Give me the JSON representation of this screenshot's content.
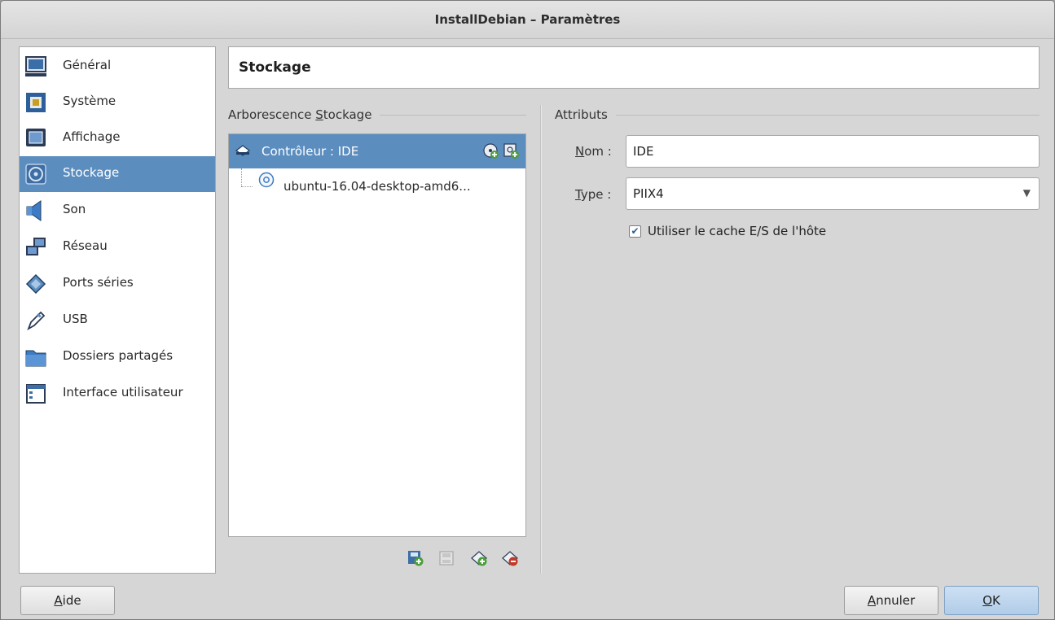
{
  "window": {
    "title": "InstallDebian – Paramètres"
  },
  "sidebar": {
    "items": [
      {
        "label": "Général",
        "icon": "monitor-icon"
      },
      {
        "label": "Système",
        "icon": "chip-icon"
      },
      {
        "label": "Affichage",
        "icon": "display-icon"
      },
      {
        "label": "Stockage",
        "icon": "storage-icon",
        "selected": true
      },
      {
        "label": "Son",
        "icon": "speaker-icon"
      },
      {
        "label": "Réseau",
        "icon": "network-icon"
      },
      {
        "label": "Ports séries",
        "icon": "serial-port-icon"
      },
      {
        "label": "USB",
        "icon": "usb-icon"
      },
      {
        "label": "Dossiers partagés",
        "icon": "folder-icon"
      },
      {
        "label": "Interface utilisateur",
        "icon": "ui-window-icon"
      }
    ]
  },
  "page": {
    "title": "Stockage"
  },
  "tree": {
    "group_prefix": "Arborescence ",
    "group_mnemonic": "S",
    "group_rest": "tockage",
    "controller_label": "Contrôleur : IDE",
    "disk_label": "ubuntu-16.04-desktop-amd6..."
  },
  "attributes": {
    "group_title": "Attributs",
    "name_mnemonic": "N",
    "name_rest": "om :",
    "name_value": "IDE",
    "type_mnemonic": "T",
    "type_rest": "ype :",
    "type_value": "PIIX4",
    "host_cache_label": "Utiliser le cache E/S de l'hôte",
    "host_cache_checked": true
  },
  "buttons": {
    "help_mnemonic": "A",
    "help_rest": "ide",
    "cancel_mnemonic": "A",
    "cancel_rest": "nnuler",
    "ok_mnemonic": "O",
    "ok_rest": "K"
  },
  "colors": {
    "selection": "#5b8dbf",
    "window_bg": "#d6d6d6"
  }
}
